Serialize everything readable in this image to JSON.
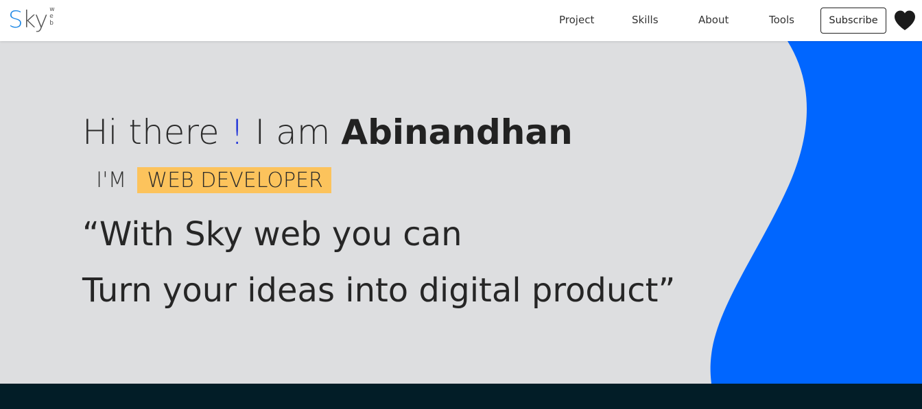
{
  "brand": {
    "logo_main_s": "S",
    "logo_main_rest": "ky",
    "logo_sub": [
      "w",
      "e",
      "b"
    ],
    "accent_color": "#1e88e5"
  },
  "nav": {
    "links": [
      {
        "label": "Project"
      },
      {
        "label": "Skills"
      },
      {
        "label": "About"
      },
      {
        "label": "Tools"
      }
    ],
    "subscribe_label": "Subscribe",
    "heart_icon": "heart-icon"
  },
  "hero": {
    "greeting_prefix": "Hi there ",
    "greeting_excl": "!",
    "greeting_mid": " I am ",
    "greeting_name": "Abinandhan",
    "role_prefix": "I'M",
    "role_title": "WEB DEVELOPER",
    "quote_line1": "“With Sky web you can",
    "quote_line2": "Turn your ideas into digital product”",
    "background_color": "#dddee0",
    "wave_color": "#0066ff",
    "badge_color": "#fcc35c"
  },
  "footer": {
    "color": "#021d27"
  }
}
